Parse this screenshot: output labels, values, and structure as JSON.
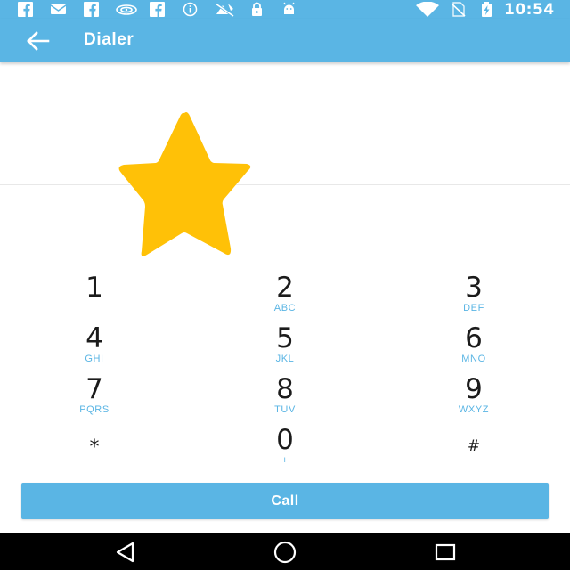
{
  "status_bar": {
    "time": "10:54",
    "left_icons": [
      "facebook-icon",
      "mail-icon",
      "facebook-icon",
      "wifi-router-icon",
      "facebook-icon",
      "info-icon",
      "no-signal-icon",
      "lock-icon",
      "android-icon"
    ],
    "right_icons": [
      "wifi-icon",
      "no-sim-icon",
      "battery-charging-icon"
    ]
  },
  "app_bar": {
    "title": "Dialer",
    "back_icon": "arrow-left-icon"
  },
  "display": {
    "number": "",
    "favorite_icon": "star-icon",
    "star_color": "#FFC107"
  },
  "keypad": {
    "keys": [
      {
        "digit": "1",
        "letters": ""
      },
      {
        "digit": "2",
        "letters": "ABC"
      },
      {
        "digit": "3",
        "letters": "DEF"
      },
      {
        "digit": "4",
        "letters": "GHI"
      },
      {
        "digit": "5",
        "letters": "JKL"
      },
      {
        "digit": "6",
        "letters": "MNO"
      },
      {
        "digit": "7",
        "letters": "PQRS"
      },
      {
        "digit": "8",
        "letters": "TUV"
      },
      {
        "digit": "9",
        "letters": "WXYZ"
      },
      {
        "digit": "*",
        "letters": ""
      },
      {
        "digit": "0",
        "letters": "+"
      },
      {
        "digit": "#",
        "letters": ""
      }
    ]
  },
  "call_button": {
    "label": "Call"
  },
  "nav_bar": {
    "back": "triangle-back-icon",
    "home": "circle-home-icon",
    "recents": "square-recents-icon"
  },
  "colors": {
    "accent": "#5AB5E4",
    "star": "#FFC107",
    "nav_bar": "#000000"
  }
}
